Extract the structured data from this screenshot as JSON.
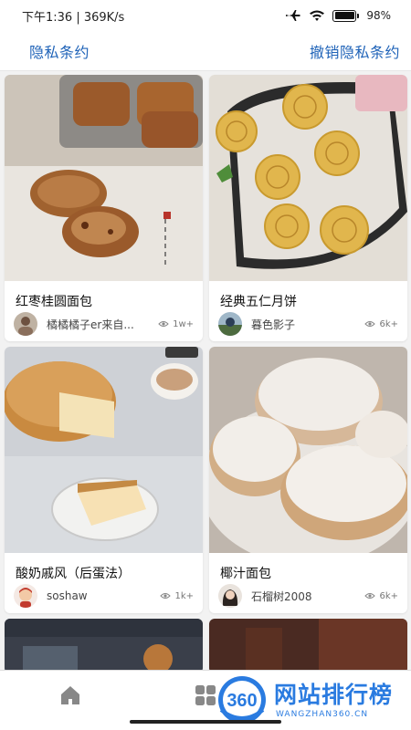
{
  "status_bar": {
    "time_speed": "下午1:36 | 369K/s",
    "battery": "98%"
  },
  "top_bar": {
    "left_link": "隐私条约",
    "right_link": "撤销隐私条约"
  },
  "recipes": [
    {
      "title": "红枣桂圆面包",
      "author": "橘橘橘子er来自...",
      "views": "1w+",
      "image": "jujube-longan-bread"
    },
    {
      "title": "经典五仁月饼",
      "author": "暮色影子",
      "views": "6k+",
      "image": "five-kernel-mooncakes"
    },
    {
      "title": "酸奶戚风（后蛋法）",
      "author": "soshaw",
      "views": "1k+",
      "image": "yogurt-chiffon-cake"
    },
    {
      "title": "椰汁面包",
      "author": "石榴树2008",
      "views": "6k+",
      "image": "coconut-milk-bread"
    }
  ],
  "bottom_nav": {
    "home_icon": "home-icon",
    "grid_icon": "grid-icon"
  },
  "watermark": {
    "number": "360",
    "title": "网站排行榜",
    "subtitle": "WANGZHAN360.CN"
  },
  "colors": {
    "link_blue": "#1f63b8",
    "watermark_blue": "#2a7be0",
    "background": "#f2f2f2"
  }
}
